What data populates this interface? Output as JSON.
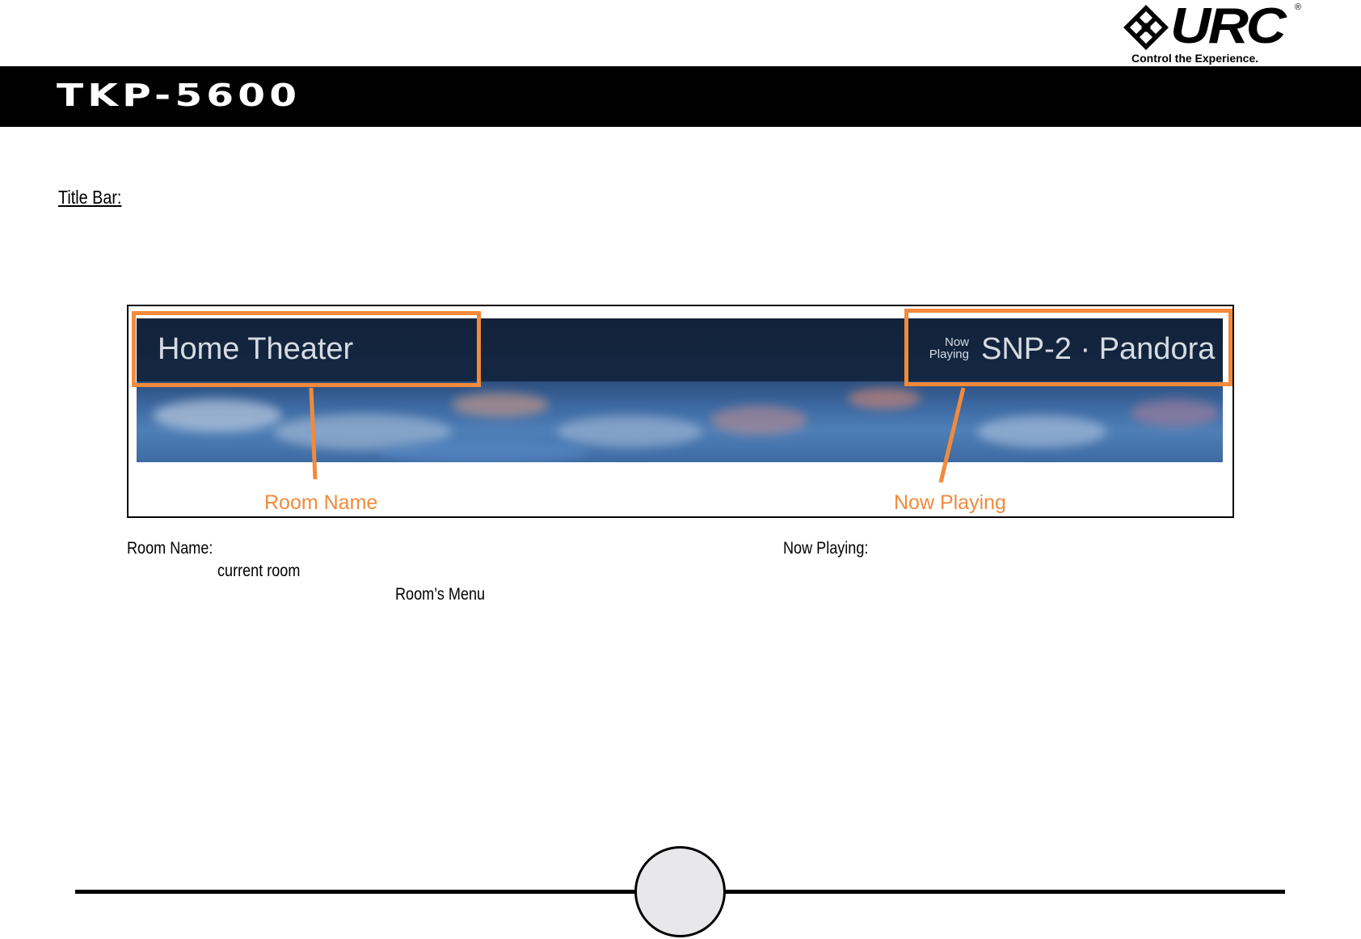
{
  "logo": {
    "letters": "URC",
    "registered": "®",
    "tagline": "Control the Experience."
  },
  "header": {
    "title": "TKP-5600"
  },
  "section": {
    "heading": "Title Bar:"
  },
  "figure": {
    "room_name": "Home Theater",
    "now_playing_label_line1": "Now",
    "now_playing_label_line2": "Playing",
    "now_playing_value": "SNP-2 · Pandora",
    "callout_room": "Room Name",
    "callout_now": "Now Playing",
    "highlight_color": "#f28a3b"
  },
  "descriptions": {
    "room_name_label": "Room Name:",
    "current_room": "current room",
    "rooms_menu": "Room’s Menu",
    "now_playing_label": "Now Playing:"
  },
  "footer": {
    "page_number": ""
  }
}
